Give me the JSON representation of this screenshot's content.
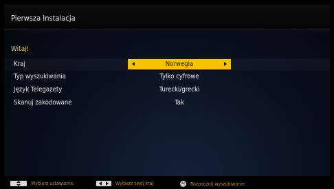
{
  "window": {
    "title": "Pierwsza Instalacja"
  },
  "welcome": "Witaj!",
  "settings": [
    {
      "label": "Kraj",
      "value": "Norwegia",
      "selected": true
    },
    {
      "label": "Typ wyszukiwania",
      "value": "Tylko cyfrowe",
      "selected": false
    },
    {
      "label": "Język Telegazety",
      "value": "Turecki/grecki",
      "selected": false
    },
    {
      "label": "Skanuj zakodowane",
      "value": "Tak",
      "selected": false
    }
  ],
  "footer": {
    "hints": [
      {
        "icon": "up-down-keys-icon",
        "label": "Wybierz ustawienie"
      },
      {
        "icon": "left-right-keys-icon",
        "label": "Wybierz swój kraj"
      },
      {
        "icon": "ok-key-icon",
        "label": "Rozpocznij wyszukiwanie",
        "key_text": "OK"
      }
    ]
  },
  "colors": {
    "accent": "#f2c400",
    "welcome": "#e8c94a",
    "hint_text": "#b88a2a",
    "background": "#0b1120"
  }
}
